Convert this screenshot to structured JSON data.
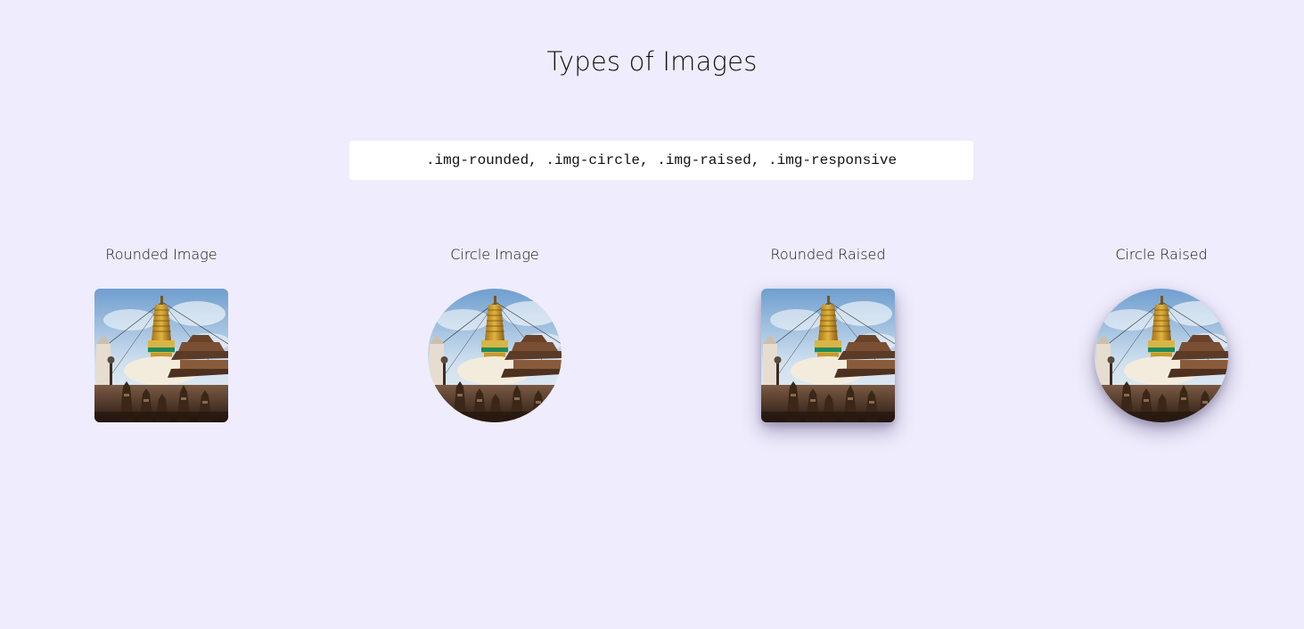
{
  "page": {
    "title": "Types of Images",
    "code_classes": ".img-rounded, .img-circle, .img-raised, .img-responsive"
  },
  "images": [
    {
      "label": "Rounded Image",
      "style": "rounded"
    },
    {
      "label": "Circle Image",
      "style": "circle"
    },
    {
      "label": "Rounded Raised",
      "style": "rounded-raised"
    },
    {
      "label": "Circle Raised",
      "style": "circle-raised"
    }
  ],
  "colors": {
    "background": "#efecfd",
    "code_box": "#ffffff"
  }
}
